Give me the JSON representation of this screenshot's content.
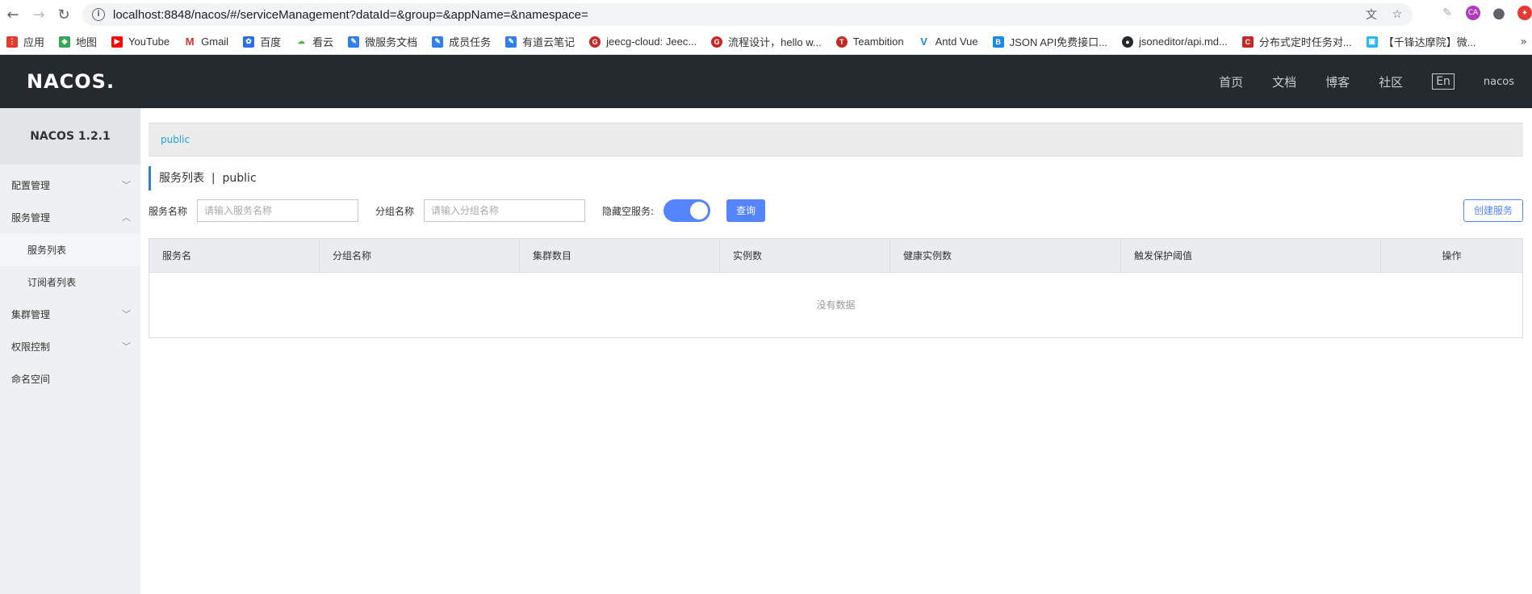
{
  "browser": {
    "url": "localhost:8848/nacos/#/serviceManagement?dataId=&group=&appName=&namespace="
  },
  "bookmarks": [
    {
      "label": "应用",
      "color": "#e53935"
    },
    {
      "label": "地图",
      "color": "#34a853"
    },
    {
      "label": "YouTube",
      "color": "#ff0000"
    },
    {
      "label": "Gmail",
      "color": "#d93025"
    },
    {
      "label": "百度",
      "color": "#2d6ef0"
    },
    {
      "label": "看云",
      "color": "#4caf50"
    },
    {
      "label": "微服务文档",
      "color": "#2f80ed"
    },
    {
      "label": "成员任务",
      "color": "#2f80ed"
    },
    {
      "label": "有道云笔记",
      "color": "#2f80ed"
    },
    {
      "label": "jeecg-cloud: Jeec...",
      "color": "#c62828"
    },
    {
      "label": "流程设计，hello w...",
      "color": "#c62828"
    },
    {
      "label": "Teambition",
      "color": "#c62828"
    },
    {
      "label": "Antd Vue",
      "color": "#1e88e5"
    },
    {
      "label": "JSON API免费接口...",
      "color": "#1e88e5"
    },
    {
      "label": "jsoneditor/api.md...",
      "color": "#24292e"
    },
    {
      "label": "分布式定时任务对...",
      "color": "#c62828"
    },
    {
      "label": "【千锋达摩院】微...",
      "color": "#29b6f6"
    }
  ],
  "header": {
    "logo": "NACOS.",
    "nav": [
      "首页",
      "文档",
      "博客",
      "社区"
    ],
    "lang": "En",
    "user": "nacos"
  },
  "sidebar": {
    "version": "NACOS 1.2.1",
    "items": [
      {
        "label": "配置管理",
        "chevron": "﹀"
      },
      {
        "label": "服务管理",
        "chevron": "︿"
      },
      {
        "label": "服务列表"
      },
      {
        "label": "订阅者列表"
      },
      {
        "label": "集群管理",
        "chevron": "﹀"
      },
      {
        "label": "权限控制",
        "chevron": "﹀"
      },
      {
        "label": "命名空间"
      }
    ]
  },
  "main": {
    "namespace": "public",
    "title": "服务列表  |  public",
    "filters": {
      "service_label": "服务名称",
      "service_placeholder": "请输入服务名称",
      "group_label": "分组名称",
      "group_placeholder": "请输入分组名称",
      "hide_empty_label": "隐藏空服务:",
      "hide_empty_on": true,
      "query_button": "查询",
      "create_button": "创建服务"
    },
    "table": {
      "columns": [
        "服务名",
        "分组名称",
        "集群数目",
        "实例数",
        "健康实例数",
        "触发保护阈值",
        "操作"
      ],
      "empty_text": "没有数据"
    }
  }
}
